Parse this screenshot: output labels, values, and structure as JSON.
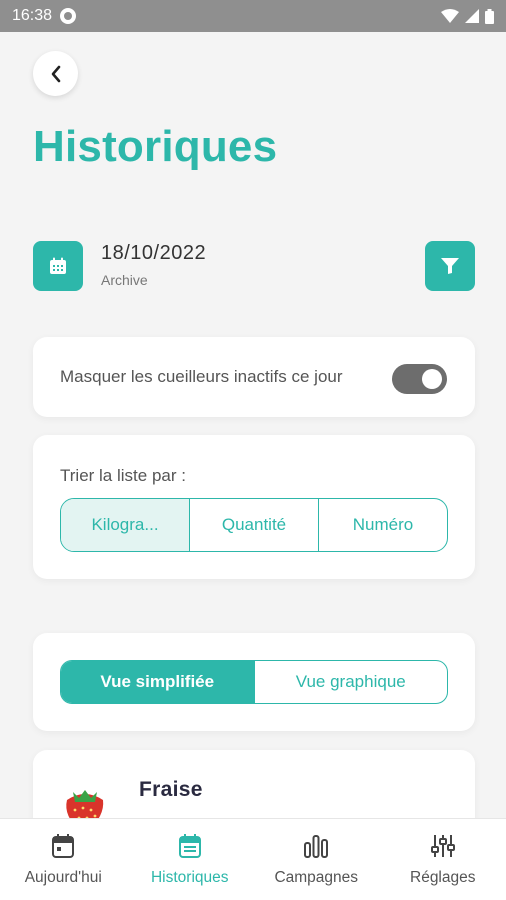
{
  "status_bar": {
    "time": "16:38"
  },
  "header": {
    "title": "Historiques"
  },
  "date": {
    "value": "18/10/2022",
    "subtitle": "Archive"
  },
  "mask_card": {
    "label": "Masquer les cueilleurs inactifs ce jour",
    "toggle_on": true
  },
  "sort_card": {
    "label": "Trier la liste par :",
    "options": [
      "Kilogra...",
      "Quantité",
      "Numéro"
    ],
    "selected": "Kilogra..."
  },
  "view_card": {
    "options": [
      "Vue simplifiée",
      "Vue graphique"
    ],
    "selected": "Vue simplifiée"
  },
  "fruit_card": {
    "name": "Fraise"
  },
  "bottom_nav": {
    "items": [
      {
        "label": "Aujourd'hui",
        "icon": "calendar-icon"
      },
      {
        "label": "Historiques",
        "icon": "history-calendar-icon",
        "active": true
      },
      {
        "label": "Campagnes",
        "icon": "bar-chart-icon"
      },
      {
        "label": "Réglages",
        "icon": "sliders-icon"
      }
    ]
  },
  "colors": {
    "accent": "#2db7aa",
    "toggle": "#6d6d6d",
    "background": "#f4f4f4"
  }
}
